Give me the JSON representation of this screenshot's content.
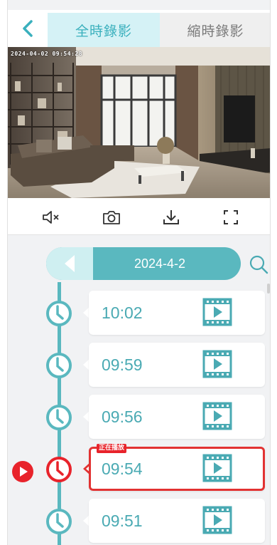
{
  "header": {
    "back_label": "back",
    "tabs": [
      {
        "label": "全時錄影",
        "active": true
      },
      {
        "label": "縮時錄影",
        "active": false
      }
    ]
  },
  "video": {
    "timestamp": "2024-04-02 09:54:28"
  },
  "controls": {
    "icons": [
      "mute-icon",
      "snapshot-icon",
      "download-icon",
      "fullscreen-icon"
    ]
  },
  "date_bar": {
    "date": "2024-4-2"
  },
  "recordings": [
    {
      "time": "10:02",
      "playing": false
    },
    {
      "time": "09:59",
      "playing": false
    },
    {
      "time": "09:56",
      "playing": false
    },
    {
      "time": "09:54",
      "playing": true,
      "tag": "正在播放"
    },
    {
      "time": "09:51",
      "playing": false
    }
  ],
  "colors": {
    "accent": "#5ab8bf",
    "accent_text": "#3ab0bd",
    "active_red": "#e8232b",
    "tab_active_bg": "#d5f2f6"
  }
}
